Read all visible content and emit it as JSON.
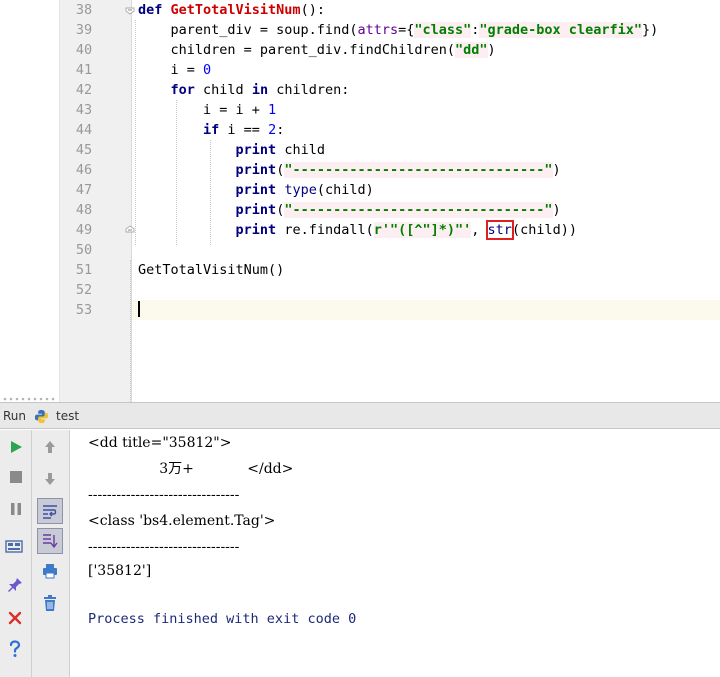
{
  "editor": {
    "lines": [
      {
        "num": "38",
        "tokens": [
          {
            "t": "def ",
            "c": "kw"
          },
          {
            "t": "GetTotalVisitNum",
            "c": "fn"
          },
          {
            "t": "():",
            "c": ""
          }
        ]
      },
      {
        "num": "39",
        "tokens": [
          {
            "t": "    parent_div = soup.find(",
            "c": ""
          },
          {
            "t": "attrs",
            "c": "kwarg"
          },
          {
            "t": "={",
            "c": ""
          },
          {
            "t": "\"class\"",
            "c": "str"
          },
          {
            "t": ":",
            "c": ""
          },
          {
            "t": "\"grade-box clearfix\"",
            "c": "str"
          },
          {
            "t": "})",
            "c": ""
          }
        ]
      },
      {
        "num": "40",
        "tokens": [
          {
            "t": "    children = parent_div.findChildren(",
            "c": ""
          },
          {
            "t": "\"dd\"",
            "c": "str"
          },
          {
            "t": ")",
            "c": ""
          }
        ]
      },
      {
        "num": "41",
        "tokens": [
          {
            "t": "    i = ",
            "c": ""
          },
          {
            "t": "0",
            "c": "num"
          }
        ]
      },
      {
        "num": "42",
        "tokens": [
          {
            "t": "    ",
            "c": ""
          },
          {
            "t": "for",
            "c": "kw"
          },
          {
            "t": " child ",
            "c": ""
          },
          {
            "t": "in",
            "c": "kw"
          },
          {
            "t": " children:",
            "c": ""
          }
        ]
      },
      {
        "num": "43",
        "tokens": [
          {
            "t": "        i = i + ",
            "c": ""
          },
          {
            "t": "1",
            "c": "num"
          }
        ]
      },
      {
        "num": "44",
        "tokens": [
          {
            "t": "        ",
            "c": ""
          },
          {
            "t": "if",
            "c": "kw"
          },
          {
            "t": " i == ",
            "c": ""
          },
          {
            "t": "2",
            "c": "num"
          },
          {
            "t": ":",
            "c": ""
          }
        ]
      },
      {
        "num": "45",
        "tokens": [
          {
            "t": "            ",
            "c": ""
          },
          {
            "t": "print",
            "c": "kw"
          },
          {
            "t": " child",
            "c": ""
          }
        ]
      },
      {
        "num": "46",
        "tokens": [
          {
            "t": "            ",
            "c": ""
          },
          {
            "t": "print",
            "c": "kw"
          },
          {
            "t": "(",
            "c": ""
          },
          {
            "t": "\"-------------------------------\"",
            "c": "str"
          },
          {
            "t": ")",
            "c": ""
          }
        ]
      },
      {
        "num": "47",
        "tokens": [
          {
            "t": "            ",
            "c": ""
          },
          {
            "t": "print",
            "c": "kw"
          },
          {
            "t": " ",
            "c": ""
          },
          {
            "t": "type",
            "c": "bi"
          },
          {
            "t": "(child)",
            "c": ""
          }
        ]
      },
      {
        "num": "48",
        "tokens": [
          {
            "t": "            ",
            "c": ""
          },
          {
            "t": "print",
            "c": "kw"
          },
          {
            "t": "(",
            "c": ""
          },
          {
            "t": "\"-------------------------------\"",
            "c": "str"
          },
          {
            "t": ")",
            "c": ""
          }
        ]
      },
      {
        "num": "49",
        "tokens": [
          {
            "t": "            ",
            "c": ""
          },
          {
            "t": "print",
            "c": "kw"
          },
          {
            "t": " re.findall(",
            "c": ""
          },
          {
            "t": "r'\"([^\"]*)\"'",
            "c": "str"
          },
          {
            "t": ", ",
            "c": ""
          },
          {
            "t": "str",
            "c": "bi hl-box"
          },
          {
            "t": "(child))",
            "c": ""
          }
        ]
      },
      {
        "num": "50",
        "tokens": []
      },
      {
        "num": "51",
        "tokens": [
          {
            "t": "GetTotalVisitNum()",
            "c": ""
          }
        ]
      },
      {
        "num": "52",
        "tokens": []
      },
      {
        "num": "53",
        "tokens": [],
        "caret": true
      }
    ]
  },
  "runbar": {
    "run_label": "Run",
    "config_name": "test"
  },
  "console": {
    "lines": [
      {
        "text": "<dd title=\"35812\">",
        "cls": ""
      },
      {
        "text": "                3万+            </dd>",
        "cls": ""
      },
      {
        "text": "--------------------------------",
        "cls": ""
      },
      {
        "text": "<class 'bs4.element.Tag'>",
        "cls": ""
      },
      {
        "text": "--------------------------------",
        "cls": ""
      },
      {
        "text": "['35812']",
        "cls": ""
      },
      {
        "text": "",
        "cls": ""
      },
      {
        "text": "Process finished with exit code 0",
        "cls": "exit"
      }
    ]
  },
  "colors": {
    "run_green": "#2ea44f",
    "stop_gray": "#8a8a8a",
    "close_red": "#d9302c",
    "help_blue": "#2f6fd6",
    "highlight_red": "#e02020"
  }
}
